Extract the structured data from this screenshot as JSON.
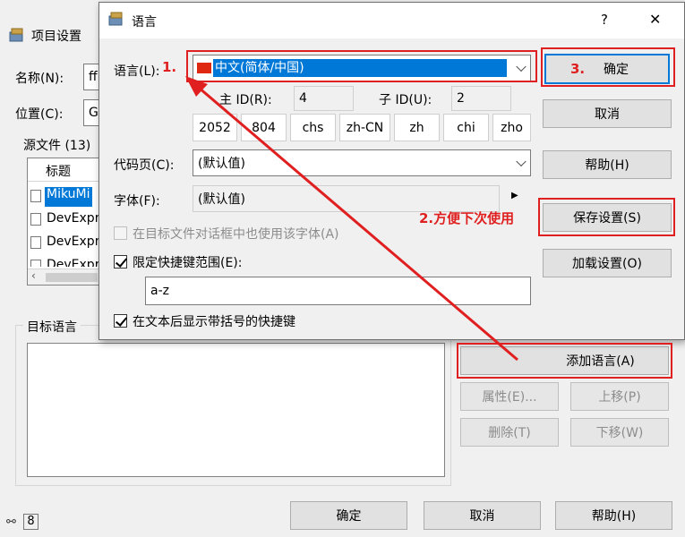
{
  "background_window": {
    "title": "项目设置",
    "name_label": "名称(N):",
    "name_value": "ff",
    "location_label": "位置(C):",
    "location_value": "G",
    "source_files_label": "源文件 (13)",
    "table_header": "标题",
    "files": [
      "MikuMi",
      "DevExpr",
      "DevExpr",
      "DevExpr"
    ],
    "target_lang_label": "目标语言",
    "buttons": {
      "add_language": "添加语言(A)",
      "properties": "属性(E)...",
      "move_up": "上移(P)",
      "delete": "删除(T)",
      "move_down": "下移(W)",
      "ok": "确定",
      "cancel": "取消",
      "help": "帮助(H)"
    },
    "status_icon": "8"
  },
  "dialog": {
    "title": "语言",
    "help_btn": "?",
    "close_btn": "✕",
    "language_label": "语言(L):",
    "language_value": "中文(简体/中国)",
    "primary_id_label": "主 ID(R):",
    "primary_id_value": "4",
    "sub_id_label": "子 ID(U):",
    "sub_id_value": "2",
    "codes": [
      "2052",
      "804",
      "chs",
      "zh-CN",
      "zh",
      "chi",
      "zho"
    ],
    "codepage_label": "代码页(C):",
    "codepage_value": "(默认值)",
    "font_label": "字体(F):",
    "font_value": "(默认值)",
    "use_font_checkbox": "在目标文件对话框中也使用该字体(A)",
    "limit_shortcut_checkbox": "限定快捷键范围(E):",
    "shortcut_range": "a-z",
    "show_shortcut_checkbox": "在文本后显示带括号的快捷键",
    "buttons": {
      "ok": "确定",
      "cancel": "取消",
      "help": "帮助(H)",
      "save_settings": "保存设置(S)",
      "load_settings": "加载设置(O)"
    }
  },
  "annotations": {
    "step1": "1.",
    "step2": "2.方便下次使用",
    "step3": "3."
  },
  "colors": {
    "selection_blue": "#0078d7",
    "annotation_red": "#e02020"
  }
}
